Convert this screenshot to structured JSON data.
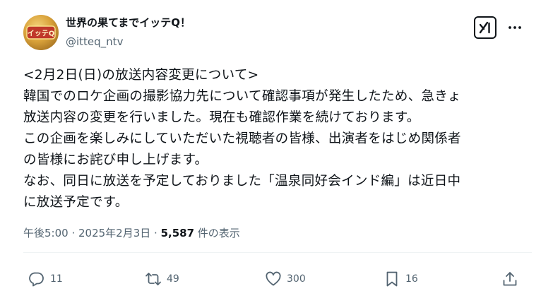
{
  "account": {
    "display_name": "世界の果てまでイッテQ！",
    "handle": "@itteq_ntv",
    "avatar_text": "イッテQ"
  },
  "post": {
    "lines": [
      "<2月2日(日)の放送内容変更について>",
      "韓国でのロケ企画の撮影協力先について確認事項が発生したため、急きょ",
      "放送内容の変更を行いました。現在も確認作業を続けております。",
      "この企画を楽しみにしていただいた視聴者の皆様、出演者をはじめ関係者",
      "の皆様にお詫び申し上げます。",
      "なお、同日に放送を予定しておりました「温泉同好会インド編」は近日中",
      "に放送予定です。"
    ]
  },
  "meta": {
    "time": "午後5:00",
    "separator": " · ",
    "date": "2025年2月3日",
    "views_count": "5,587",
    "views_label": " 件の表示"
  },
  "actions": {
    "reply_count": "11",
    "retweet_count": "49",
    "like_count": "300",
    "bookmark_count": "16"
  },
  "icons": {
    "grok": "grok-icon",
    "more": "more-icon",
    "reply": "reply-icon",
    "retweet": "retweet-icon",
    "like": "heart-icon",
    "bookmark": "bookmark-icon",
    "share": "share-icon"
  },
  "colors": {
    "text": "#0f1419",
    "secondary": "#536471",
    "divider": "#eff3f4"
  }
}
